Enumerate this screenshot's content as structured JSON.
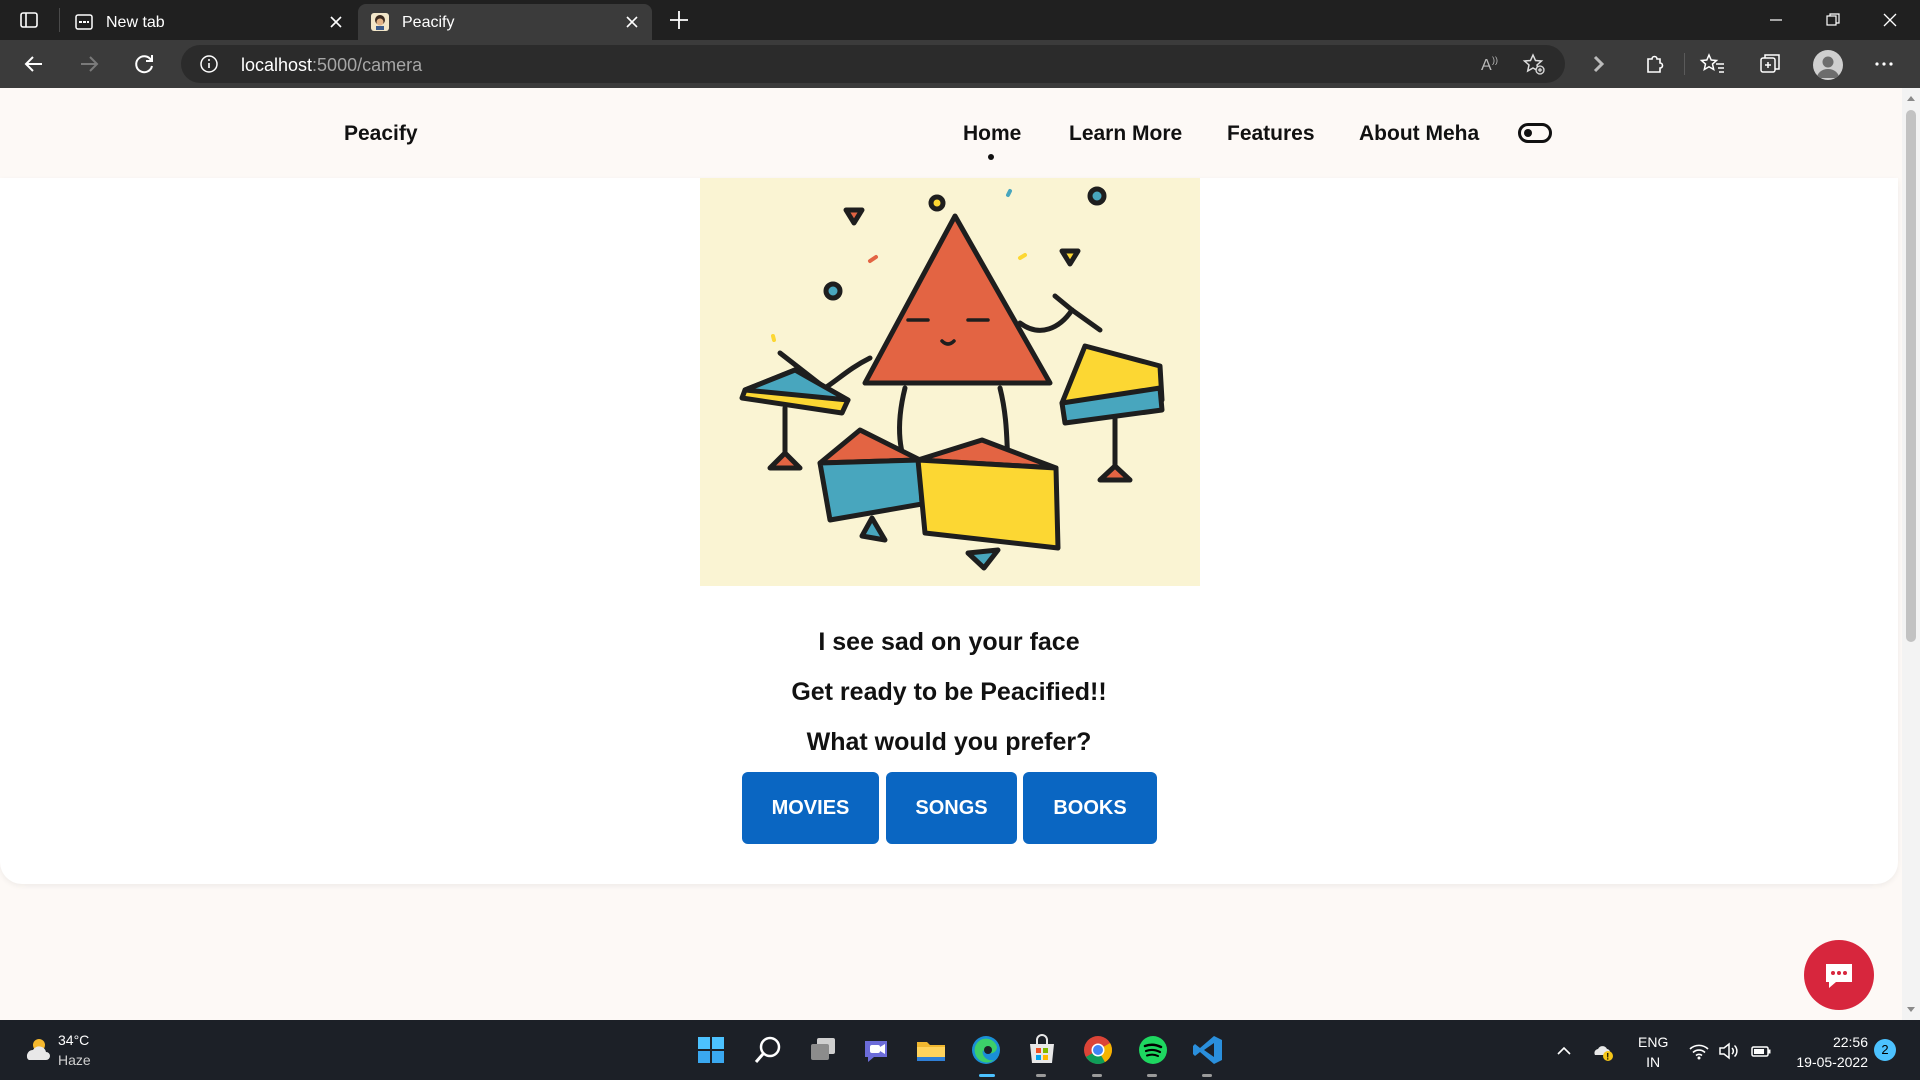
{
  "browser": {
    "tabs": [
      {
        "title": "New tab",
        "active": false
      },
      {
        "title": "Peacify",
        "active": true
      }
    ],
    "address": {
      "host": "localhost",
      "path": ":5000/camera"
    }
  },
  "site": {
    "brand": "Peacify",
    "nav": [
      {
        "label": "Home",
        "active": true
      },
      {
        "label": "Learn More",
        "active": false
      },
      {
        "label": "Features",
        "active": false
      },
      {
        "label": "About Meha",
        "active": false
      }
    ]
  },
  "content": {
    "line1": "I see sad on your face",
    "line2": "Get ready to be Peacified!!",
    "line3": "What would you prefer?",
    "buttons": [
      "MOVIES",
      "SONGS",
      "BOOKS"
    ]
  },
  "taskbar": {
    "weather": {
      "temp": "34°C",
      "condition": "Haze"
    },
    "lang": {
      "line1": "ENG",
      "line2": "IN"
    },
    "clock": {
      "time": "22:56",
      "date": "19-05-2022"
    },
    "notifications": "2"
  },
  "colors": {
    "primary_button": "#0a66c2",
    "chat_button": "#d7263d",
    "illustration_bg": "#faf4d3"
  }
}
